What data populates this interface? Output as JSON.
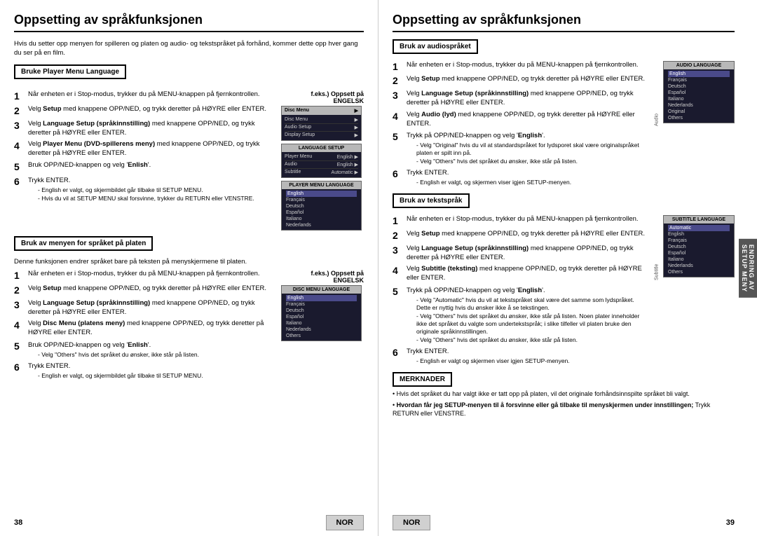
{
  "left": {
    "title": "Oppsetting av språkfunksjonen",
    "intro": "Hvis du setter opp menyen for spilleren og platen og audio- og tekstspråket på forhånd, kommer dette opp hver gang du ser på en film.",
    "section1": {
      "label": "Bruke Player Menu Language",
      "feks": "f.eks.) Oppsett på ENGELSK",
      "steps": [
        {
          "num": "1",
          "text": "Når enheten er i Stop-modus, trykker du på MENU-knappen på fjernkontrollen."
        },
        {
          "num": "2",
          "text": "Velg <b>Setup</b> med knappene OPP/NED, og trykk deretter på HØYRE eller ENTER."
        },
        {
          "num": "3",
          "text": "Velg <b>Language Setup (språkinnstilling)</b> med knappene OPP/NED, og trykk deretter på HØYRE eller ENTER."
        },
        {
          "num": "4",
          "text": "Velg <b>Player Menu (DVD-spillerens meny)</b> med knappene OPP/NED, og trykk deretter på HØYRE eller ENTER."
        },
        {
          "num": "5",
          "text": "Bruk OPP/NED-knappen og velg '<b>Enlish</b>'."
        },
        {
          "num": "6",
          "text": "Trykk ENTER.",
          "notes": [
            "- English er valgt, og skjermbildet går tilbake til SETUP MENU.",
            "- Hvis du vil at SETUP MENU skal forsvinne, trykker du RETURN eller VENSTRE."
          ]
        }
      ],
      "screen1": {
        "header": "Disc Menu",
        "rows": [
          {
            "label": "Disc Menu",
            "value": "",
            "menu": true
          },
          {
            "label": "Audio Setup",
            "value": "",
            "menu": true
          },
          {
            "label": "Display Setup",
            "value": "",
            "menu": true
          }
        ]
      },
      "screen2": {
        "header": "LANGUAGE SETUP",
        "rows": [
          {
            "label": "Player Menu",
            "value": "English"
          },
          {
            "label": "Audio",
            "value": "English"
          },
          {
            "label": "Subtitle",
            "value": "Automatic"
          }
        ]
      },
      "screen3": {
        "header": "PLAYER MENU LANGUAGE",
        "langs": [
          "English",
          "Français",
          "Deutsch",
          "Español",
          "Italiano",
          "Nederlands"
        ]
      }
    },
    "section2": {
      "label": "Bruk av menyen for språket på platen",
      "intro": "Denne funksjonen endrer språket bare på teksten på menyskjermene til platen.",
      "feks": "f.eks.) Oppsett på ENGELSK",
      "steps": [
        {
          "num": "1",
          "text": "Når enheten er i Stop-modus, trykker du på MENU-knappen på fjernkontrollen."
        },
        {
          "num": "2",
          "text": "Velg <b>Setup</b> med knappene OPP/NED, og trykk deretter på HØYRE eller ENTER."
        },
        {
          "num": "3",
          "text": "Velg <b>Language Setup (språkinnstilling)</b> med knappene OPP/NED, og trykk deretter på HØYRE eller ENTER."
        },
        {
          "num": "4",
          "text": "Velg <b>Disc Menu (platens meny)</b> med knappene OPP/NED, og trykk deretter på HØYRE eller ENTER."
        },
        {
          "num": "5",
          "text": "Bruk OPP/NED-knappen og velg '<b>Enlish</b>'.",
          "notes": [
            "- Velg \"Others\" hvis det språket du ønsker, ikke står på listen."
          ]
        },
        {
          "num": "6",
          "text": "Trykk ENTER.",
          "notes": [
            "- English er valgt, og skjermbildet går tilbake til SETUP MENU."
          ]
        }
      ],
      "screen1": {
        "header": "DISC MENU LANGUAGE",
        "langs": [
          "English",
          "Français",
          "Deutsch",
          "Español",
          "Italiano",
          "Nederlands",
          "Others"
        ]
      }
    },
    "page_number": "38",
    "nor": "NOR"
  },
  "right": {
    "title": "Oppsetting av språkfunksjonen",
    "section1": {
      "label": "Bruk av audiospråket",
      "steps": [
        {
          "num": "1",
          "text": "Når enheten er i Stop-modus, trykker du på MENU-knappen på fjernkontrollen."
        },
        {
          "num": "2",
          "text": "Velg <b>Setup</b> med knappene OPP/NED, og trykk deretter på HØYRE eller ENTER."
        },
        {
          "num": "3",
          "text": "Velg <b>Language Setup (språkinnstilling)</b> med knappene OPP/NED, og trykk deretter på HØYRE eller ENTER."
        },
        {
          "num": "4",
          "text": "Velg <b>Audio (lyd)</b> med knappene OPP/NED, og trykk deretter på HØYRE eller ENTER."
        },
        {
          "num": "5",
          "text": "Trykk på OPP/NED-knappen og velg '<b>English</b>'.",
          "notes": [
            "- Velg \"Original\" hvis du vil at standardspråket for  lydsporet skal være originalspråket platen er spilt inn på.",
            "- Velg \"Others\" hvis det språket du ønsker, ikke står på listen."
          ]
        },
        {
          "num": "6",
          "text": "Trykk ENTER.",
          "notes": [
            "- English er valgt, og skjermen viser igjen SETUP-menyen."
          ]
        }
      ],
      "screen": {
        "header": "AUDIO LANGUAGE",
        "side_label": "Audio",
        "langs": [
          "English",
          "Français",
          "Deutsch",
          "Español",
          "Italiano",
          "Nederlands",
          "Original",
          "Others"
        ]
      }
    },
    "section2": {
      "label": "Bruk av tekstspråk",
      "steps": [
        {
          "num": "1",
          "text": "Når enheten er i Stop-modus, trykker du på MENU-knappen på fjernkontrollen."
        },
        {
          "num": "2",
          "text": "Velg <b>Setup</b> med knappene OPP/NED, og trykk deretter på HØYRE eller ENTER."
        },
        {
          "num": "3",
          "text": "Velg <b>Language Setup (språkinnstilling)</b> med knappene OPP/NED, og trykk deretter på HØYRE eller ENTER."
        },
        {
          "num": "4",
          "text": "Velg <b>Subtitle (teksting)</b> med knappene OPP/NED, og trykk deretter på HØYRE eller ENTER."
        },
        {
          "num": "5",
          "text": "Trykk på OPP/NED-knappen og velg '<b>English</b>'.",
          "notes": [
            "- Velg \"Automatic\" hvis du vil at tekstspråket skal være det samme som lydspråket. Dette er nyttig hvis du ønsker ikke å se tekstingen.",
            "- Velg \"Others\" hvis det språket du ønsker, ikke står på listen. Noen plater inneholder ikke det språket du valgte som undertekstspråk; i slike tilfeller vil platen bruke den originale språkinnstillingen.",
            "- Velg \"Others\" hvis det språket du ønsker, ikke står på listen."
          ]
        },
        {
          "num": "6",
          "text": "Trykk ENTER.",
          "notes": [
            "- English er valgt og skjermen viser igjen SETUP-menyen."
          ]
        }
      ],
      "screen": {
        "header": "SUBTITLE LANGUAGE",
        "side_label": "Subtitle",
        "langs": [
          "Automatic",
          "English",
          "Français",
          "Deutsch",
          "Español",
          "Italiano",
          "Nederlands",
          "Others"
        ]
      }
    },
    "merknader": {
      "label": "MERKNADER",
      "items": [
        "Hvis det språket du har valgt ikke er tatt opp på platen, vil det originale forhåndsinnspilte språket bli valgt.",
        "• Hvordan får jeg SETUP-menyen til å forsvinne eller gå tilbake til menyskjermen under innstillingen; Trykk RETURN eller VENSTRE."
      ]
    },
    "sidebar_label": "ENDRING AV SETUP MENY",
    "page_number": "39",
    "nor": "NOR"
  }
}
